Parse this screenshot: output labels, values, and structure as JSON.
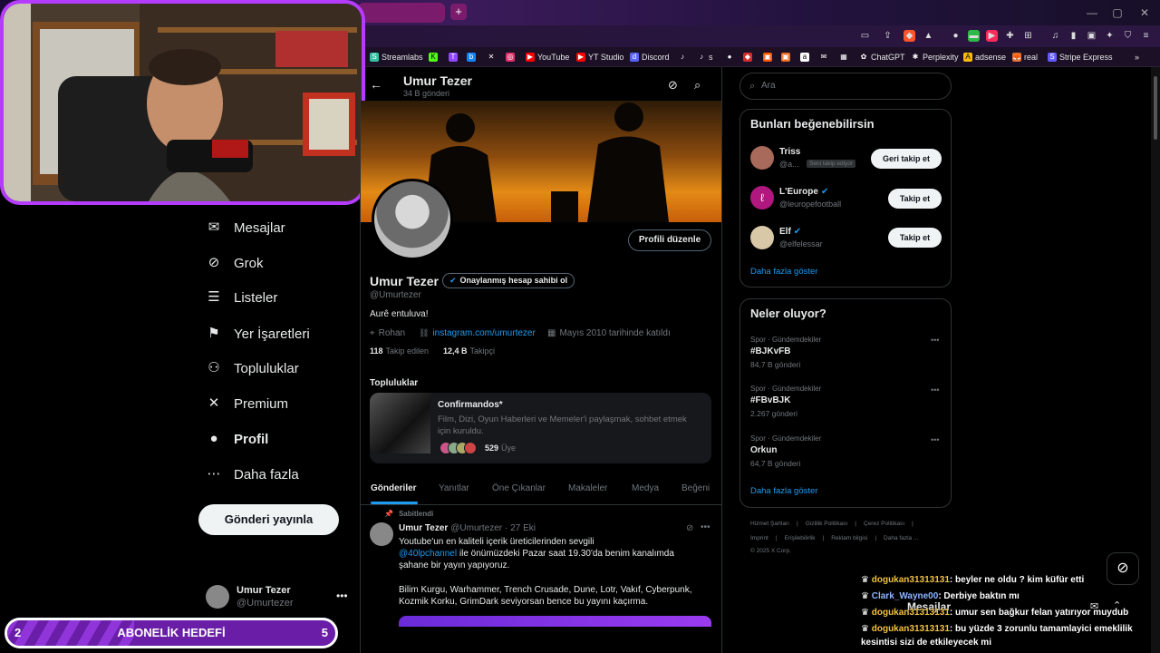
{
  "browser": {
    "bookmarks": [
      "Streamlabs",
      "YouTube",
      "YT Studio",
      "Discord",
      "s",
      "ChatGPT",
      "Perplexity",
      "adsense",
      "real",
      "Stripe Express"
    ]
  },
  "nav": {
    "items": [
      {
        "label": "Mesajlar",
        "icon": "mail-icon",
        "glyph": "✉"
      },
      {
        "label": "Grok",
        "icon": "grok-icon",
        "glyph": "⊘"
      },
      {
        "label": "Listeler",
        "icon": "list-icon",
        "glyph": "☰"
      },
      {
        "label": "Yer İşaretleri",
        "icon": "bookmark-icon",
        "glyph": "⚑"
      },
      {
        "label": "Topluluklar",
        "icon": "communities-icon",
        "glyph": "⚇"
      },
      {
        "label": "Premium",
        "icon": "x-icon",
        "glyph": "✕"
      },
      {
        "label": "Profil",
        "icon": "profile-icon",
        "glyph": "●"
      },
      {
        "label": "Daha fazla",
        "icon": "more-icon",
        "glyph": "⋯"
      }
    ],
    "post_button": "Gönderi yayınla",
    "account_name": "Umur Tezer",
    "account_handle": "@Umurtezer"
  },
  "goal": {
    "left": "2",
    "label": "ABONELİK HEDEFİ",
    "right": "5"
  },
  "profile": {
    "header_name": "Umur Tezer",
    "header_posts": "34 B gönderi",
    "edit_button": "Profili düzenle",
    "name": "Umur Tezer",
    "verified_badge": "Onaylanmış hesap sahibi ol",
    "handle": "@Umurtezer",
    "bio": "Aurê entuluva!",
    "location": "Rohan",
    "link": "instagram.com/umurtezer",
    "joined": "Mayıs 2010 tarihinde katıldı",
    "following_count": "118",
    "following_label": "Takip edilen",
    "followers_count": "12,4 B",
    "followers_label": "Takipçi",
    "communities_title": "Topluluklar",
    "community_name": "Confirmandos*",
    "community_desc": "Film, Dizi, Oyun Haberleri ve Memeler'i paylaşmak, sohbet etmek için kuruldu.",
    "community_members": "529",
    "community_members_label": "Üye",
    "tabs": [
      "Gönderiler",
      "Yanıtlar",
      "Öne Çıkanlar",
      "Makaleler",
      "Medya",
      "Beğeni"
    ]
  },
  "tweet": {
    "pinned": "Sabitlendi",
    "name": "Umur Tezer",
    "handle": "@Umurtezer",
    "date": "· 27 Eki",
    "line1": "Youtube'un en kaliteli içerik üreticilerinden sevgili",
    "mention": "@40lpchannel",
    "line2": " ile önümüzdeki Pazar saat 19.30'da benim kanalımda",
    "line3": "şahane bir yayın yapıyoruz.",
    "line4": "Bilim Kurgu, Warhammer, Trench Crusade, Dune, Lotr, Vakıf, Cyberpunk,",
    "line5": "Kozmik Korku, GrimDark seviyorsan bence bu yayını kaçırma."
  },
  "sidebar": {
    "search_placeholder": "Ara",
    "wtf_title": "Bunları beğenebilirsin",
    "suggestions": [
      {
        "name": "Triss",
        "handle": "@a...",
        "tag": "Seni takip ediyor",
        "button": "Geri takip et"
      },
      {
        "name": "L'Europe",
        "handle": "@leuropefootball",
        "tag": "",
        "button": "Takip et"
      },
      {
        "name": "Elf",
        "handle": "@elfelessar",
        "tag": "",
        "button": "Takip et"
      }
    ],
    "show_more": "Daha fazla göster",
    "trends_title": "Neler oluyor?",
    "trends": [
      {
        "context": "Spor · Gündemdekiler",
        "name": "#BJKvFB",
        "count": "84,7 B gönderi"
      },
      {
        "context": "Spor · Gündemdekiler",
        "name": "#FBvBJK",
        "count": "2.267 gönderi"
      },
      {
        "context": "Spor · Gündemdekiler",
        "name": "Orkun",
        "count": "64,7 B gönderi"
      }
    ],
    "trends_more": "Daha fazla göster",
    "footer1": [
      "Hizmet Şartları",
      "Gizlilik Politikası",
      "Çerez Politikası"
    ],
    "footer2": [
      "Imprint",
      "Erişilebilirlik",
      "Reklam bilgisi",
      "Daha fazla ..."
    ],
    "copyright": "© 2025 X Corp.",
    "messages_label": "Mesajlar"
  },
  "chat": [
    {
      "user": "dogukan31313131",
      "msg": ": beyler ne oldu ? kim küfür etti"
    },
    {
      "user": "Clark_Wayne00",
      "msg": ": Derbiye baktın mı"
    },
    {
      "user": "dogukan31313131",
      "msg": ": umur sen bağkur felan yatırıyor muydub"
    },
    {
      "user": "dogukan31313131",
      "msg": ": bu yüzde 3 zorunlu tamamlayici emeklilik"
    },
    {
      "user": "",
      "msg": "kesintisi sizi de etkileyecek mi"
    }
  ],
  "colors": {
    "accent": "#1d9bf0",
    "brand_purple": "#b53cff",
    "link": "#6e8bff"
  }
}
